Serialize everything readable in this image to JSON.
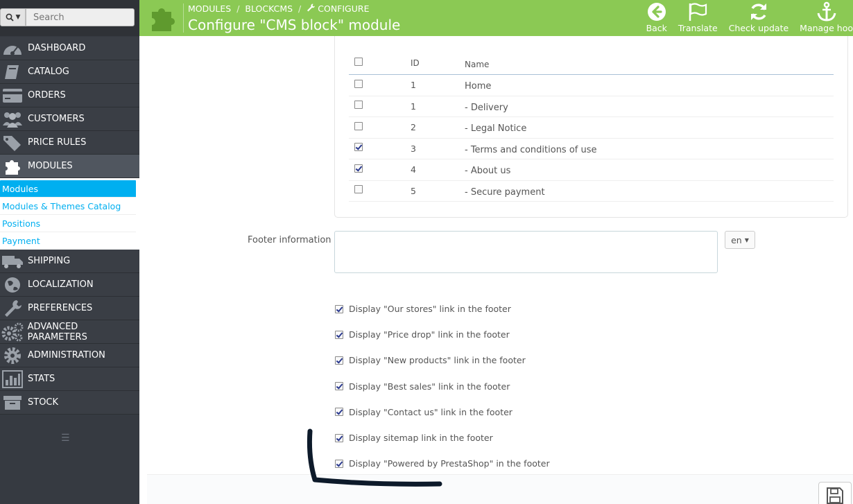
{
  "search": {
    "placeholder": "Search",
    "button_icon": "search-icon"
  },
  "sidebar": {
    "items": [
      {
        "label": "DASHBOARD",
        "icon": "dashboard-icon"
      },
      {
        "label": "CATALOG",
        "icon": "book-icon"
      },
      {
        "label": "ORDERS",
        "icon": "credit-card-icon"
      },
      {
        "label": "CUSTOMERS",
        "icon": "users-icon"
      },
      {
        "label": "PRICE RULES",
        "icon": "tags-icon"
      },
      {
        "label": "MODULES",
        "icon": "puzzle-icon"
      },
      {
        "label": "SHIPPING",
        "icon": "truck-icon"
      },
      {
        "label": "LOCALIZATION",
        "icon": "globe-icon"
      },
      {
        "label": "PREFERENCES",
        "icon": "wrench-icon"
      },
      {
        "label": "ADVANCED PARAMETERS",
        "icon": "cogs-icon"
      },
      {
        "label": "ADMINISTRATION",
        "icon": "cog-icon"
      },
      {
        "label": "STATS",
        "icon": "bar-chart-icon"
      },
      {
        "label": "STOCK",
        "icon": "archive-icon"
      }
    ],
    "submenu": [
      {
        "label": "Modules"
      },
      {
        "label": "Modules & Themes Catalog"
      },
      {
        "label": "Positions"
      },
      {
        "label": "Payment"
      }
    ]
  },
  "header": {
    "breadcrumb": [
      "MODULES",
      "BLOCKCMS",
      "CONFIGURE"
    ],
    "title": "Configure \"CMS block\" module",
    "toolbar": [
      {
        "label": "Back",
        "icon": "arrow-circle-left-icon"
      },
      {
        "label": "Translate",
        "icon": "flag-icon"
      },
      {
        "label": "Check update",
        "icon": "refresh-icon"
      },
      {
        "label": "Manage hoo",
        "icon": "anchor-icon"
      }
    ],
    "accent": "#8bc954"
  },
  "cms_table": {
    "headers": [
      "ID",
      "Name"
    ],
    "rows": [
      {
        "id": "1",
        "name": "Home",
        "checked": false
      },
      {
        "id": "1",
        "name": "- Delivery",
        "checked": false
      },
      {
        "id": "2",
        "name": "- Legal Notice",
        "checked": false
      },
      {
        "id": "3",
        "name": "- Terms and conditions of use",
        "checked": true
      },
      {
        "id": "4",
        "name": "- About us",
        "checked": true
      },
      {
        "id": "5",
        "name": "- Secure payment",
        "checked": false
      }
    ]
  },
  "footer_info": {
    "label": "Footer information",
    "value": "",
    "lang": "en"
  },
  "options": [
    {
      "label": "Display \"Our stores\" link in the footer",
      "checked": true
    },
    {
      "label": "Display \"Price drop\" link in the footer",
      "checked": true
    },
    {
      "label": "Display \"New products\" link in the footer",
      "checked": true
    },
    {
      "label": "Display \"Best sales\" link in the footer",
      "checked": true
    },
    {
      "label": "Display \"Contact us\" link in the footer",
      "checked": true
    },
    {
      "label": "Display sitemap link in the footer",
      "checked": true
    },
    {
      "label": "Display \"Powered by PrestaShop\" in the footer",
      "checked": true
    }
  ],
  "colors": {
    "sidebar": "#363a41",
    "link": "#00aff0",
    "annotation": "#0d1a2a"
  }
}
